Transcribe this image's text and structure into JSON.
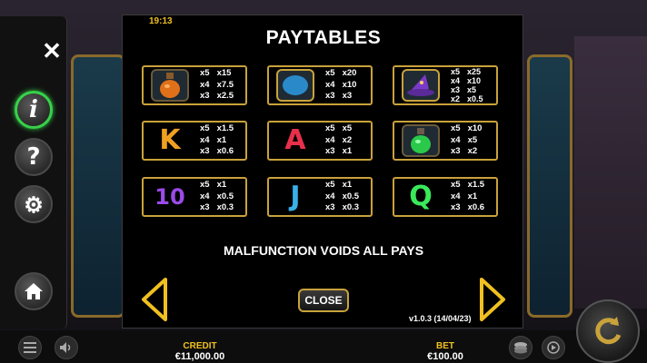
{
  "clock": "19:13",
  "title": "PAYTABLES",
  "paytable": [
    {
      "symbol": "potion-orange",
      "rows": [
        [
          "x5",
          "x15"
        ],
        [
          "x4",
          "x7.5"
        ],
        [
          "x3",
          "x2.5"
        ]
      ]
    },
    {
      "symbol": "moon-gem",
      "rows": [
        [
          "x5",
          "x20"
        ],
        [
          "x4",
          "x10"
        ],
        [
          "x3",
          "x3"
        ]
      ]
    },
    {
      "symbol": "wizard-hat",
      "rows": [
        [
          "x5",
          "x25"
        ],
        [
          "x4",
          "x10"
        ],
        [
          "x3",
          "x5"
        ],
        [
          "x2",
          "x0.5"
        ]
      ]
    },
    {
      "symbol": "K",
      "rows": [
        [
          "x5",
          "x1.5"
        ],
        [
          "x4",
          "x1"
        ],
        [
          "x3",
          "x0.6"
        ]
      ]
    },
    {
      "symbol": "A",
      "rows": [
        [
          "x5",
          "x5"
        ],
        [
          "x4",
          "x2"
        ],
        [
          "x3",
          "x1"
        ]
      ]
    },
    {
      "symbol": "potion-green",
      "rows": [
        [
          "x5",
          "x10"
        ],
        [
          "x4",
          "x5"
        ],
        [
          "x3",
          "x2"
        ]
      ]
    },
    {
      "symbol": "10",
      "rows": [
        [
          "x5",
          "x1"
        ],
        [
          "x4",
          "x0.5"
        ],
        [
          "x3",
          "x0.3"
        ]
      ]
    },
    {
      "symbol": "J",
      "rows": [
        [
          "x5",
          "x1"
        ],
        [
          "x4",
          "x0.5"
        ],
        [
          "x3",
          "x0.3"
        ]
      ]
    },
    {
      "symbol": "Q",
      "rows": [
        [
          "x5",
          "x1.5"
        ],
        [
          "x4",
          "x1"
        ],
        [
          "x3",
          "x0.6"
        ]
      ]
    }
  ],
  "notice": "MALFUNCTION VOIDS ALL PAYS",
  "close_label": "CLOSE",
  "version": "v1.0.3 (14/04/23)",
  "credit": {
    "label": "CREDIT",
    "value": "€11,000.00"
  },
  "bet": {
    "label": "BET",
    "value": "€100.00"
  },
  "colors": {
    "accent": "#c9a23a",
    "highlight": "#f0c020",
    "active": "#37d24a"
  },
  "icons": [
    "close-icon",
    "info-icon",
    "help-icon",
    "gear-icon",
    "home-icon",
    "menu-icon",
    "sound-icon",
    "coin-stack-icon",
    "autoplay-icon",
    "spin-icon",
    "arrow-left-icon",
    "arrow-right-icon"
  ]
}
